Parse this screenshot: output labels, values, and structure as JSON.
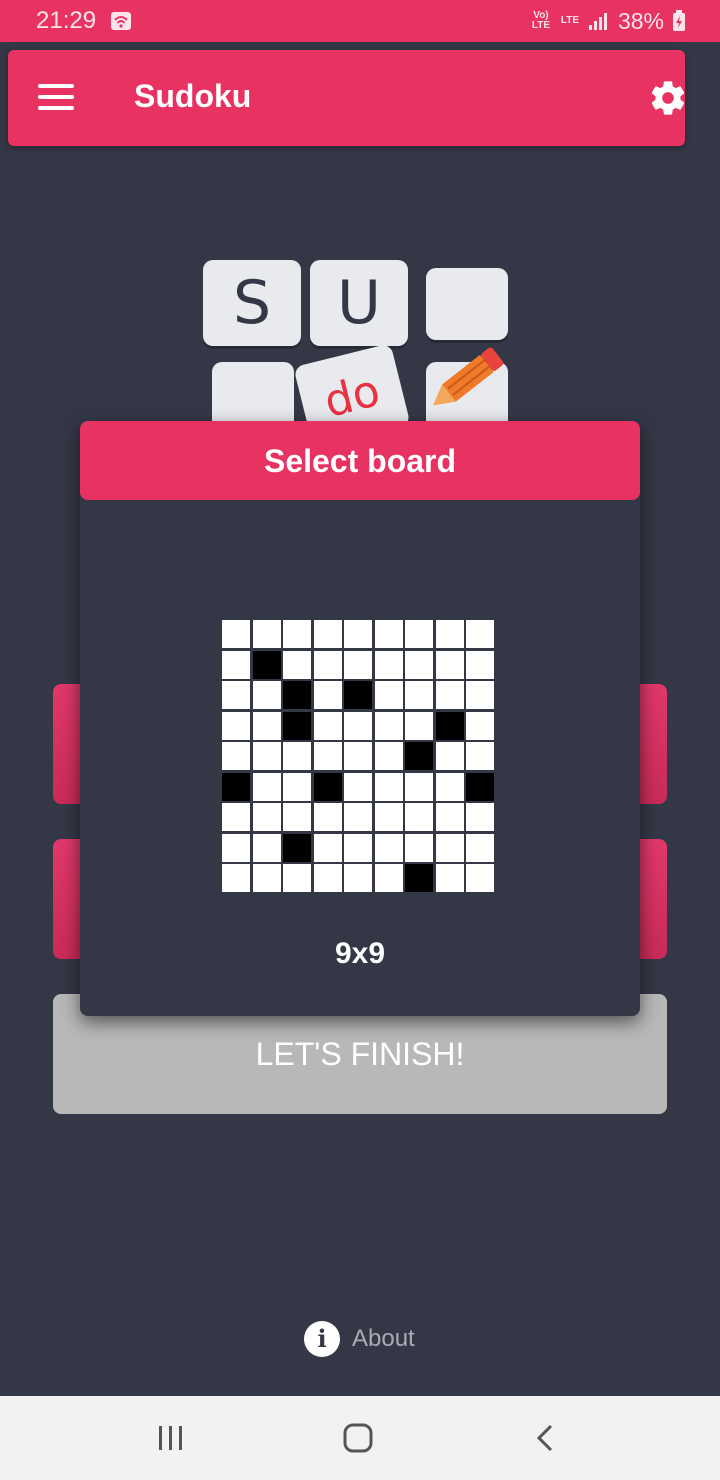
{
  "status_bar": {
    "time": "21:29",
    "network_top": "Vo) LTE",
    "network_second": "LTE",
    "battery": "38%",
    "icons": [
      "wifi-hotspot-icon",
      "signal-icon",
      "battery-charging-icon"
    ]
  },
  "app_bar": {
    "title": "Sudoku",
    "menu_icon": "hamburger-menu-icon",
    "settings_icon": "gear-icon"
  },
  "logo": {
    "letters": [
      "S",
      "U",
      "",
      "",
      "do",
      ""
    ]
  },
  "main": {
    "finish_button": "LET'S FINISH!",
    "about_label": "About",
    "about_icon": "info-icon"
  },
  "dialog": {
    "title": "Select board",
    "board_size": "9x9",
    "board_rows": [
      "000000000",
      "010000000",
      "001010000",
      "001000010",
      "000000100",
      "100100001",
      "000000000",
      "001000000",
      "000000100"
    ]
  },
  "nav_bar": {
    "icons": [
      "recent-apps-icon",
      "home-icon",
      "back-icon"
    ]
  },
  "colors": {
    "accent": "#e83262",
    "background": "#343746",
    "finish_button": "#b8b8b8"
  }
}
